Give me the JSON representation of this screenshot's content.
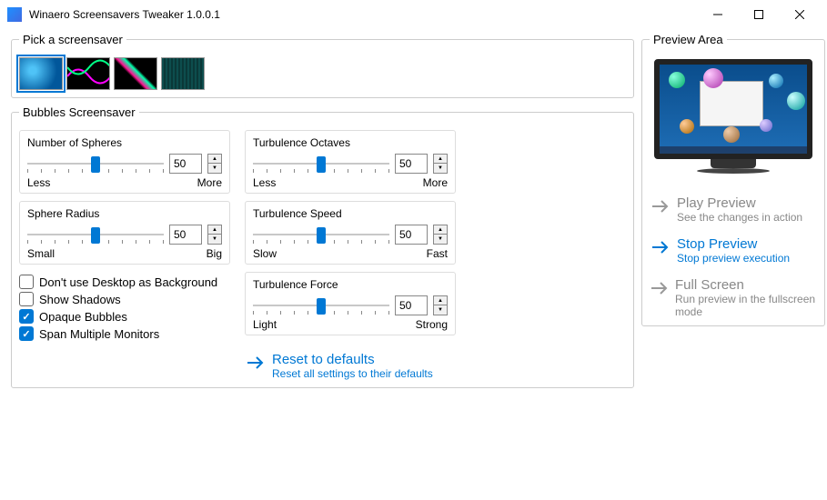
{
  "window": {
    "title": "Winaero Screensavers Tweaker 1.0.0.1"
  },
  "picker": {
    "legend": "Pick a screensaver"
  },
  "settings": {
    "legend": "Bubbles Screensaver",
    "spheres": {
      "label": "Number of Spheres",
      "value": "50",
      "min": "Less",
      "max": "More"
    },
    "radius": {
      "label": "Sphere Radius",
      "value": "50",
      "min": "Small",
      "max": "Big"
    },
    "octaves": {
      "label": "Turbulence Octaves",
      "value": "50",
      "min": "Less",
      "max": "More"
    },
    "speed": {
      "label": "Turbulence Speed",
      "value": "50",
      "min": "Slow",
      "max": "Fast"
    },
    "force": {
      "label": "Turbulence Force",
      "value": "50",
      "min": "Light",
      "max": "Strong"
    },
    "checks": {
      "nodesktop": "Don't use Desktop as Background",
      "shadows": "Show Shadows",
      "opaque": "Opaque Bubbles",
      "span": "Span Multiple Monitors"
    },
    "reset": {
      "title": "Reset to defaults",
      "sub": "Reset all settings to their defaults"
    }
  },
  "preview": {
    "legend": "Preview Area",
    "play": {
      "title": "Play Preview",
      "sub": "See the changes in action"
    },
    "stop": {
      "title": "Stop Preview",
      "sub": "Stop preview execution"
    },
    "full": {
      "title": "Full Screen",
      "sub": "Run preview in the fullscreen mode"
    }
  }
}
